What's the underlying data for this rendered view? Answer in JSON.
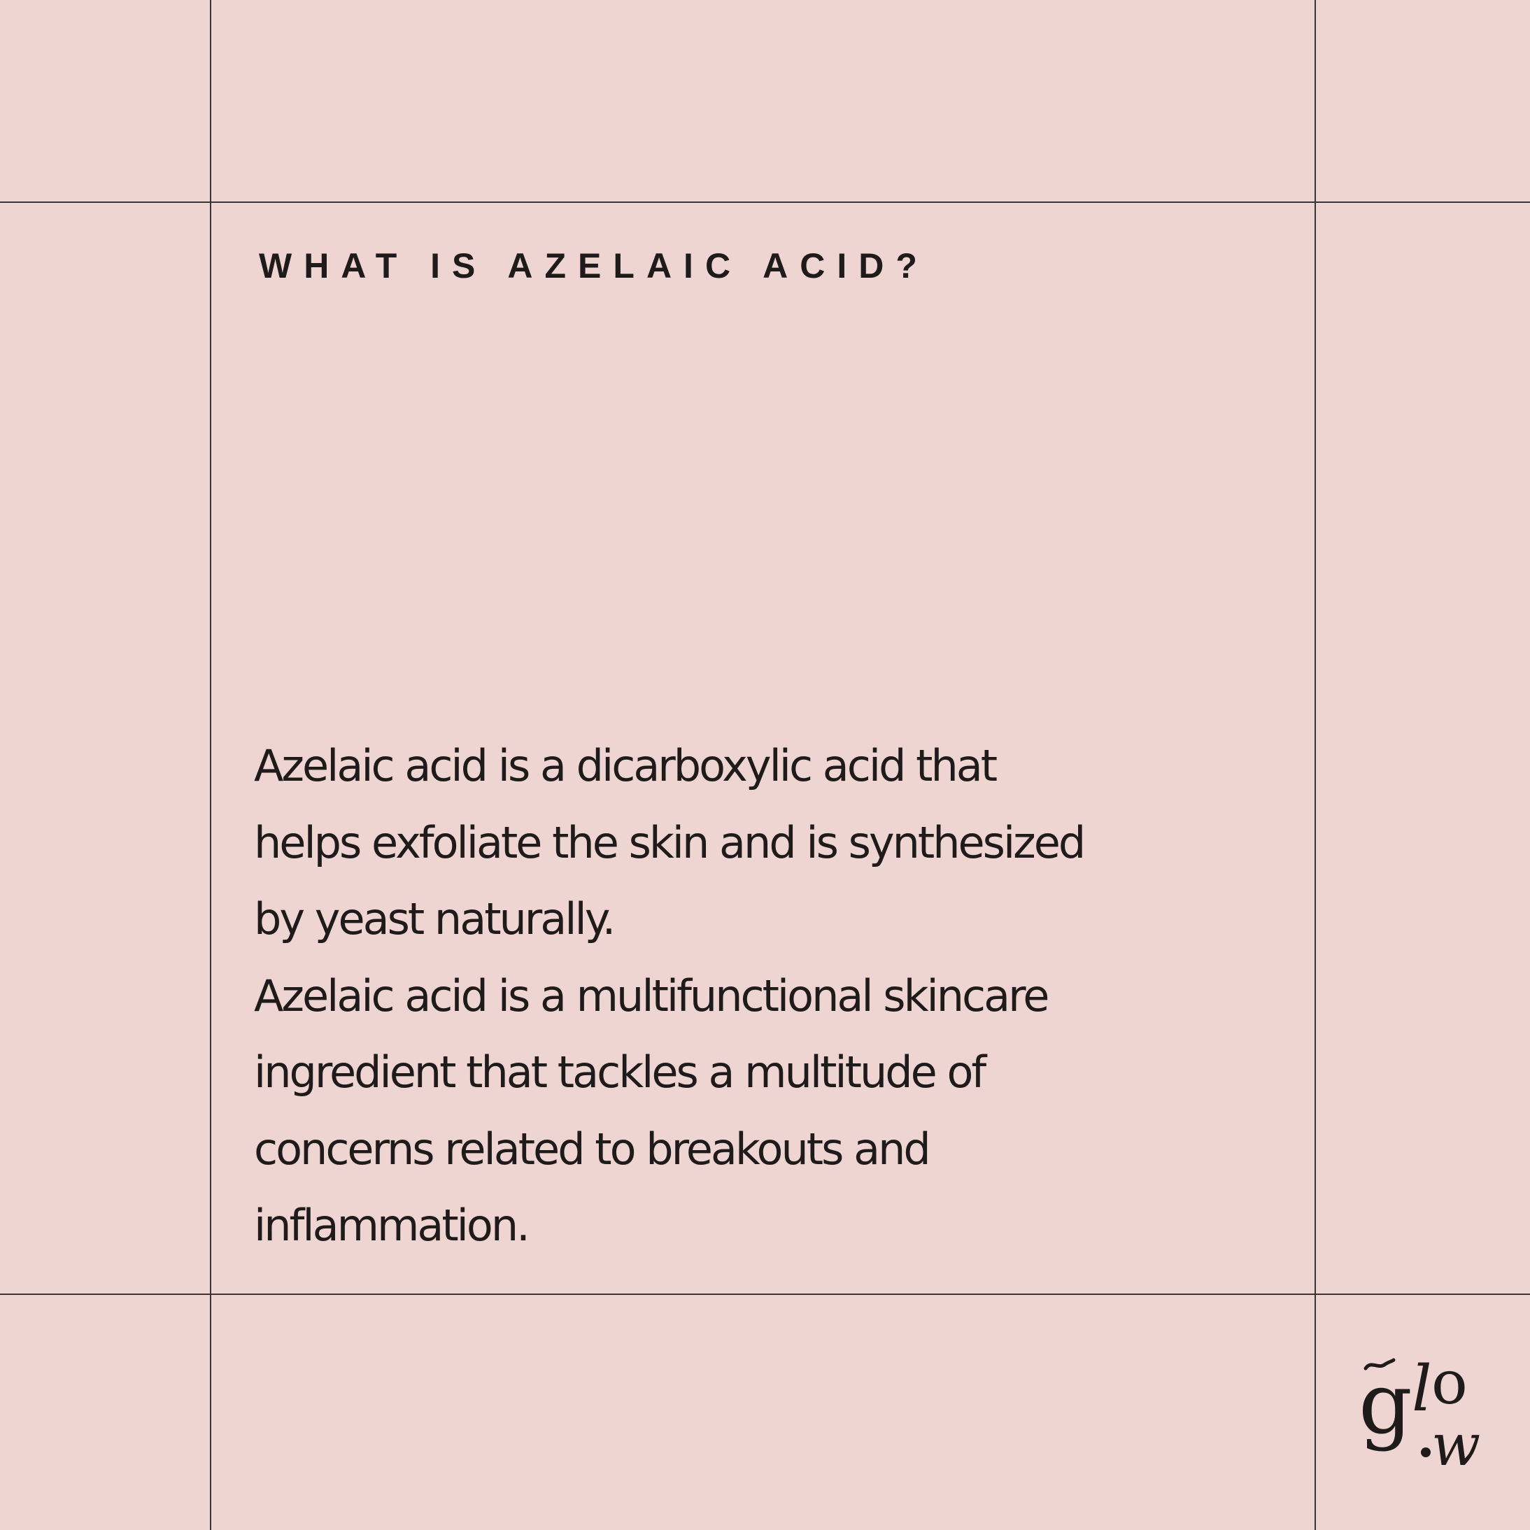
{
  "heading": "WHAT IS AZELAIC ACID?",
  "body_lines": [
    "Azelaic acid is a dicarboxylic acid that",
    "helps exfoliate the skin and is synthesized",
    "by yeast naturally.",
    "Azelaic acid is a multifunctional skincare",
    "ingredient that tackles a multitude of",
    "concerns related to breakouts and",
    "inflammation."
  ],
  "logo": {
    "text": "glow",
    "icon": "glow-logo"
  },
  "colors": {
    "background": "#efd5d1",
    "text": "#1f1b1b",
    "grid_lines": "#3a3434"
  }
}
